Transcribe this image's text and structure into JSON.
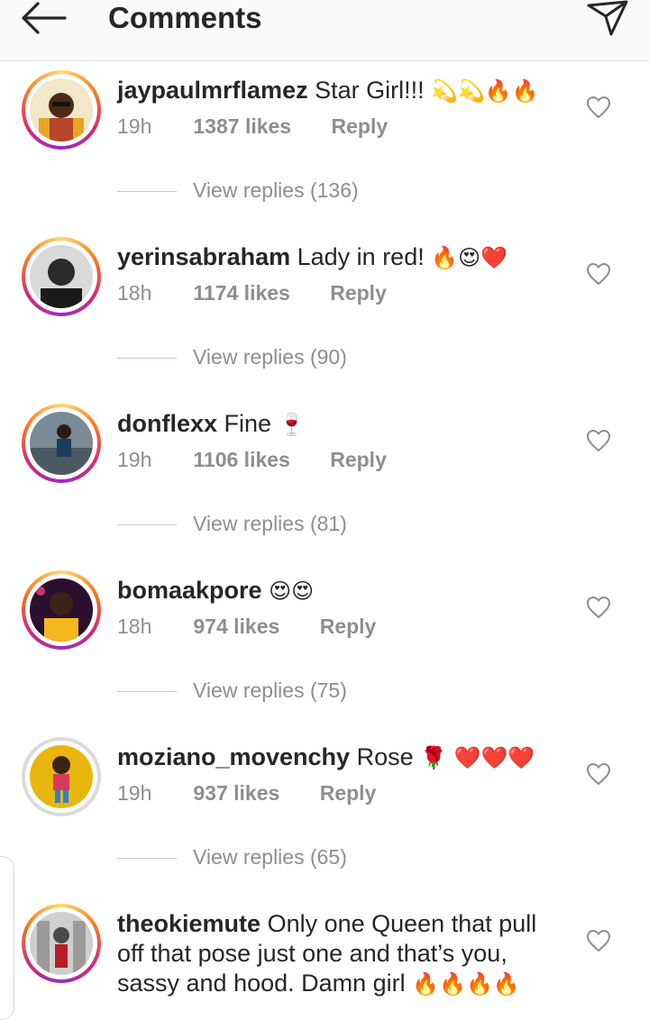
{
  "header": {
    "title": "Comments"
  },
  "comments": [
    {
      "username": "jaypaulmrflamez",
      "text": "Star Girl!!!",
      "emoji": "💫💫🔥🔥",
      "time": "19h",
      "likes": "1387 likes",
      "reply": "Reply",
      "view_replies": "View replies (136)"
    },
    {
      "username": "yerinsabraham",
      "text": "Lady in red!",
      "emoji": "🔥😍❤️",
      "time": "18h",
      "likes": "1174 likes",
      "reply": "Reply",
      "view_replies": "View replies (90)"
    },
    {
      "username": "donflexx",
      "text": "Fine",
      "emoji": "🍷",
      "time": "19h",
      "likes": "1106 likes",
      "reply": "Reply",
      "view_replies": "View replies (81)"
    },
    {
      "username": "bomaakpore",
      "text": "",
      "emoji": "😍😍",
      "time": "18h",
      "likes": "974 likes",
      "reply": "Reply",
      "view_replies": "View replies (75)"
    },
    {
      "username": "moziano_movenchy",
      "text": "Rose",
      "emoji": "🌹 ❤️❤️❤️",
      "time": "19h",
      "likes": "937 likes",
      "reply": "Reply",
      "view_replies": "View replies (65)"
    },
    {
      "username": "theokiemute",
      "text": "Only one Queen that pull off that pose just one and that’s you, sassy and hood. Damn girl",
      "emoji": "🔥🔥🔥🔥",
      "time": "",
      "likes": "",
      "reply": "",
      "view_replies": ""
    }
  ],
  "colors": {
    "muted": "#8e8e8e",
    "text": "#262626",
    "ring": "#d62976"
  },
  "icons": [
    "back-arrow-icon",
    "send-icon",
    "heart-outline-icon"
  ]
}
